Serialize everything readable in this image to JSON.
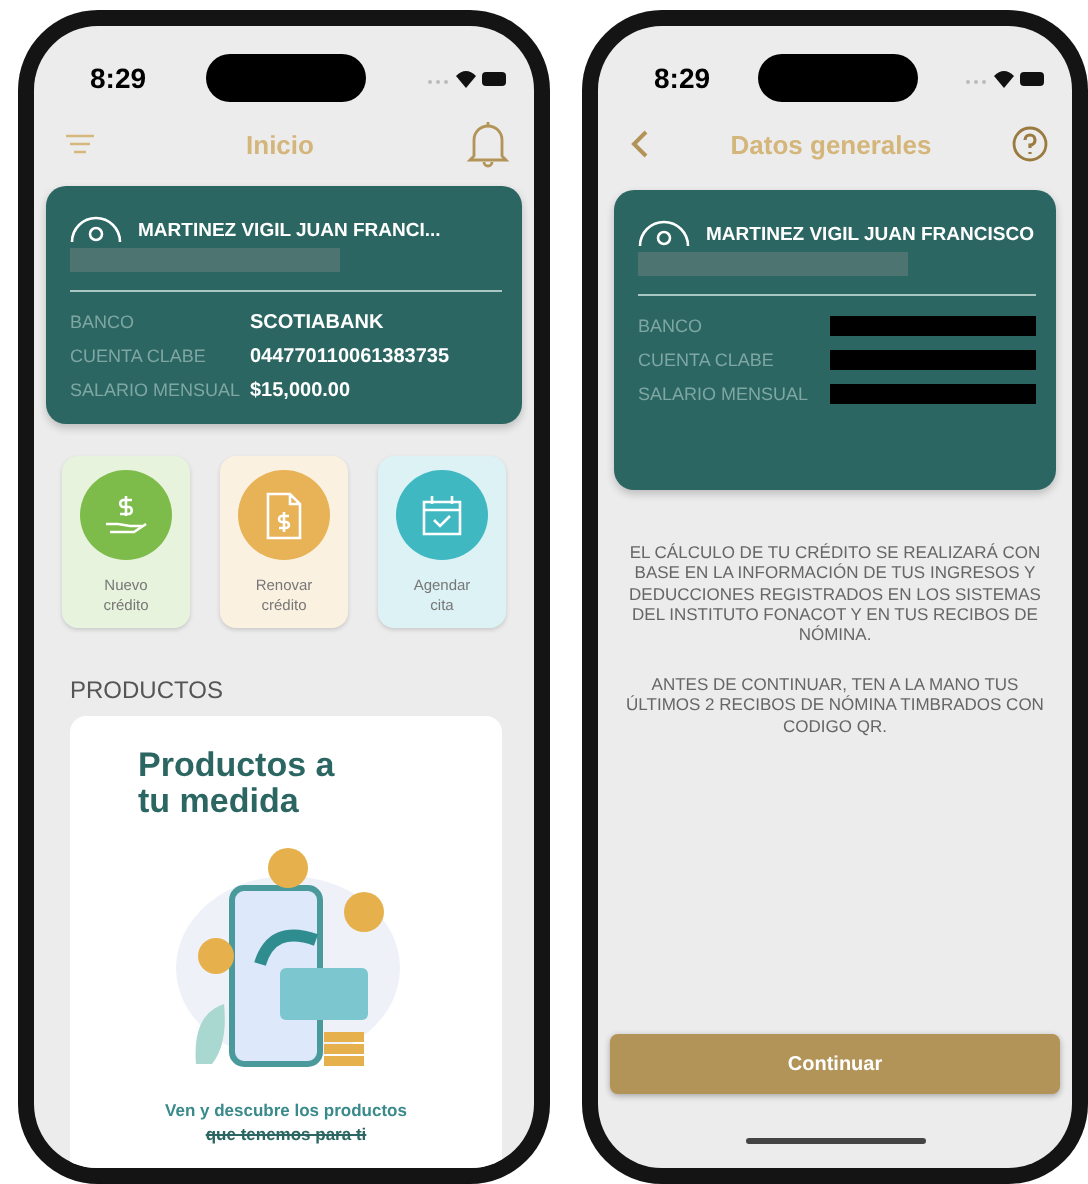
{
  "home_screen": {
    "status_time": "8:29",
    "title": "Inicio",
    "account_card": {
      "name": "MARTINEZ VIGIL JUAN FRANCI...",
      "rows": [
        {
          "label": "BANCO",
          "value": "SCOTIABANK"
        },
        {
          "label": "CUENTA CLABE",
          "value": "044770110061383735"
        },
        {
          "label": "SALARIO MENSUAL",
          "value": "$15,000.00"
        }
      ]
    },
    "actions": [
      {
        "kind": "money",
        "label": "Nuevo crédito",
        "color": "#7dbb4a"
      },
      {
        "kind": "document",
        "label": "Renovar crédito",
        "color": "#e8b257"
      },
      {
        "kind": "calendar",
        "label": "Agendar cita",
        "color": "#3fb8c2"
      }
    ],
    "section_title": "PRODUCTOS",
    "promo": {
      "title": "Productos a tu medida",
      "caption": "Ven y descubre los productos",
      "caption_covered": "que tenemos para ti"
    }
  },
  "details_screen": {
    "status_time": "8:29",
    "title": "Datos generales",
    "account_card": {
      "name": "MARTINEZ VIGIL JUAN FRANCISCO",
      "rows": [
        {
          "label": "BANCO"
        },
        {
          "label": "CUENTA CLABE"
        },
        {
          "label": "SALARIO MENSUAL"
        }
      ]
    },
    "paragraphs": [
      "EL CÁLCULO DE TU CRÉDITO SE REALIZARÁ CON BASE EN LA INFORMACIÓN DE TUS INGRESOS Y DEDUCCIONES REGISTRADOS EN LOS SISTEMAS DEL INSTITUTO FONACOT Y EN TUS RECIBOS DE NÓMINA.",
      "ANTES DE CONTINUAR, TEN A LA MANO TUS ÚLTIMOS 2 RECIBOS DE NÓMINA TIMBRADOS CON CODIGO QR."
    ],
    "button": "Continuar"
  }
}
